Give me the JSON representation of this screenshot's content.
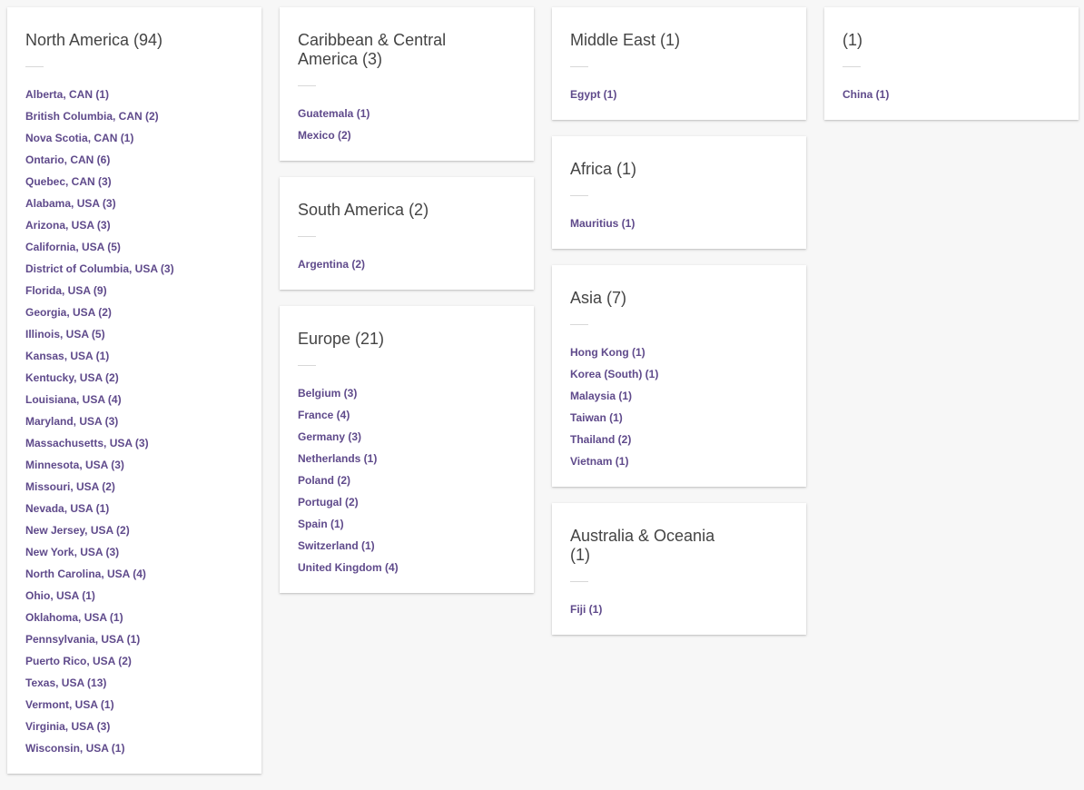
{
  "colors": {
    "link": "#5f4a8b",
    "heading": "#444444",
    "background": "#f7f7f7",
    "card": "#ffffff"
  },
  "regions": [
    {
      "title": "North America (94)",
      "items": [
        "Alberta, CAN (1)",
        "British Columbia, CAN (2)",
        "Nova Scotia, CAN (1)",
        "Ontario, CAN (6)",
        "Quebec, CAN (3)",
        "Alabama, USA (3)",
        "Arizona, USA (3)",
        "California, USA (5)",
        "District of Columbia, USA (3)",
        "Florida, USA (9)",
        "Georgia, USA (2)",
        "Illinois, USA (5)",
        "Kansas, USA (1)",
        "Kentucky, USA (2)",
        "Louisiana, USA (4)",
        "Maryland, USA (3)",
        "Massachusetts, USA (3)",
        "Minnesota, USA (3)",
        "Missouri, USA (2)",
        "Nevada, USA (1)",
        "New Jersey, USA (2)",
        "New York, USA (3)",
        "North Carolina, USA (4)",
        "Ohio, USA (1)",
        "Oklahoma, USA (1)",
        "Pennsylvania, USA (1)",
        "Puerto Rico, USA (2)",
        "Texas, USA (13)",
        "Vermont, USA (1)",
        "Virginia, USA (3)",
        "Wisconsin, USA (1)"
      ]
    },
    {
      "title": "Caribbean & Central America (3)",
      "items": [
        "Guatemala (1)",
        "Mexico (2)"
      ]
    },
    {
      "title": "South America (2)",
      "items": [
        "Argentina (2)"
      ]
    },
    {
      "title": "Europe (21)",
      "items": [
        "Belgium (3)",
        "France (4)",
        "Germany (3)",
        "Netherlands (1)",
        "Poland (2)",
        "Portugal (2)",
        "Spain (1)",
        "Switzerland (1)",
        "United Kingdom (4)"
      ]
    },
    {
      "title": "Middle East (1)",
      "items": [
        "Egypt (1)"
      ]
    },
    {
      "title": "Africa (1)",
      "items": [
        "Mauritius (1)"
      ]
    },
    {
      "title": "Asia (7)",
      "items": [
        "Hong Kong (1)",
        "Korea (South) (1)",
        "Malaysia (1)",
        "Taiwan (1)",
        "Thailand (2)",
        "Vietnam (1)"
      ]
    },
    {
      "title": "Australia & Oceania (1)",
      "items": [
        "Fiji (1)"
      ]
    },
    {
      "title": "(1)",
      "items": [
        "China (1)"
      ]
    }
  ]
}
